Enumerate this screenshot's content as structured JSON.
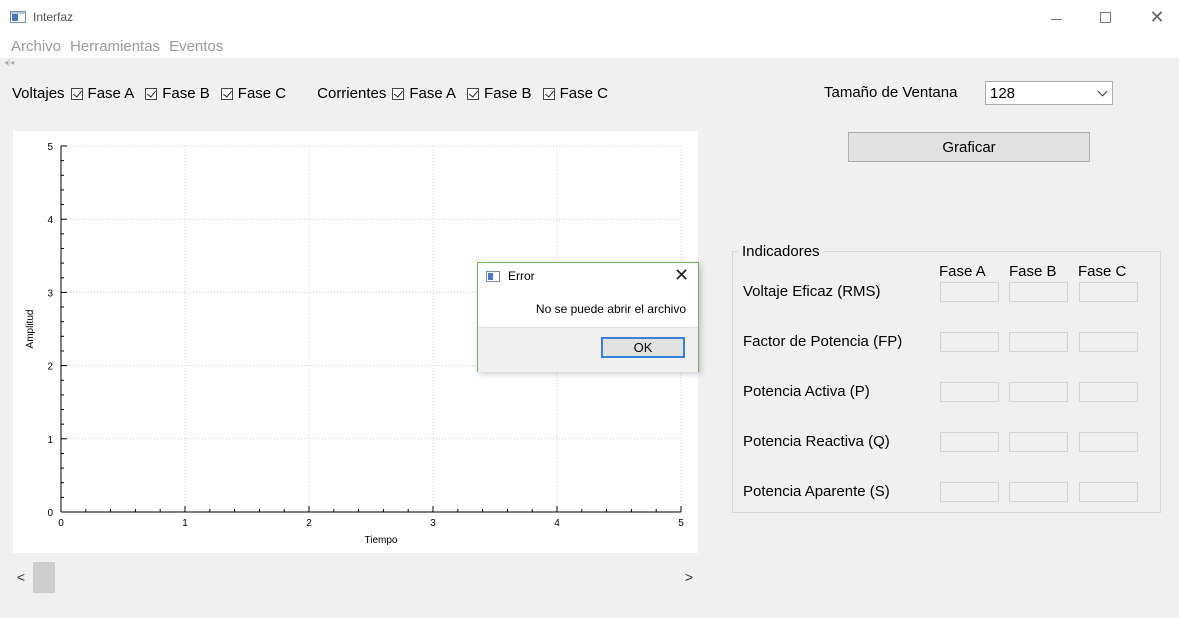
{
  "window": {
    "title": "Interfaz",
    "controls": {
      "minimize": "—",
      "maximize": "□",
      "close": "✕"
    }
  },
  "menu": [
    "Archivo",
    "Herramientas",
    "Eventos"
  ],
  "checks": {
    "voltajes": {
      "label": "Voltajes",
      "items": [
        "Fase A",
        "Fase B",
        "Fase C"
      ],
      "checked": [
        true,
        true,
        true
      ]
    },
    "corrientes": {
      "label": "Corrientes",
      "items": [
        "Fase A",
        "Fase B",
        "Fase C"
      ],
      "checked": [
        true,
        true,
        true
      ]
    }
  },
  "window_size": {
    "label": "Tamaño de Ventana",
    "value": "128"
  },
  "graficar_label": "Graficar",
  "indicadores": {
    "title": "Indicadores",
    "phases": [
      "Fase A",
      "Fase B",
      "Fase C"
    ],
    "rows": [
      "Voltaje Eficaz (RMS)",
      "Factor de Potencia (FP)",
      "Potencia Activa (P)",
      "Potencia Reactiva (Q)",
      "Potencia Aparente (S)"
    ]
  },
  "scrollbar": {
    "left_arrow": "<",
    "right_arrow": ">"
  },
  "dialog": {
    "title": "Error",
    "close": "✕",
    "message": "No se puede abrir el archivo",
    "ok_label": "OK"
  },
  "chart_data": {
    "type": "line",
    "series": [],
    "xlabel": "Tiempo",
    "ylabel": "Amplitud",
    "xlim": [
      0,
      5
    ],
    "ylim": [
      0,
      5
    ],
    "xticks": [
      "0",
      "1",
      "2",
      "3",
      "4",
      "5"
    ],
    "yticks": [
      "0",
      "1",
      "2",
      "3",
      "4",
      "5"
    ],
    "grid": true
  }
}
